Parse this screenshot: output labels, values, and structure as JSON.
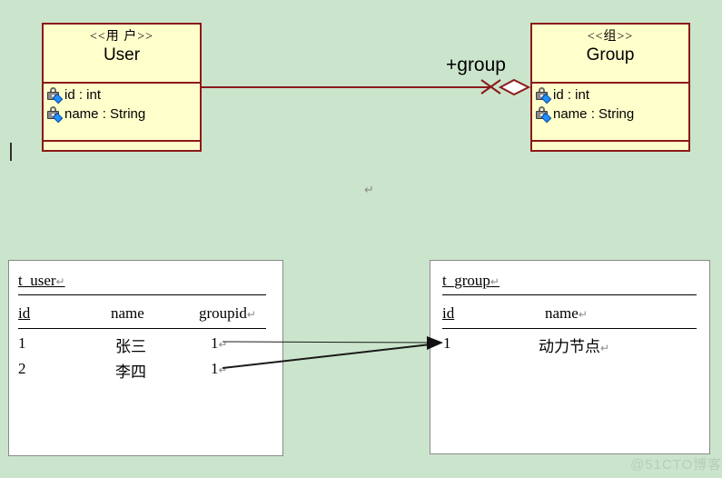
{
  "background_color": "#cbe5cc",
  "uml": {
    "line_color": "#8b1a1a",
    "fill_color": "#ffffcc",
    "association": {
      "role_label": "+group",
      "end_marker": "aggregation-diamond"
    },
    "classes": [
      {
        "stereotype": "<<用 户>>",
        "name": "User",
        "attributes": [
          {
            "visibility": "private",
            "text": "id : int"
          },
          {
            "visibility": "private",
            "text": "name : String"
          }
        ],
        "operations": []
      },
      {
        "stereotype": "<<组>>",
        "name": "Group",
        "attributes": [
          {
            "visibility": "private",
            "text": "id : int"
          },
          {
            "visibility": "private",
            "text": "name : String"
          }
        ],
        "operations": []
      }
    ]
  },
  "tables": {
    "border_color": "#8a8a8a",
    "fill_color": "#ffffff",
    "t_user": {
      "title": "t_user",
      "title_mark": "↵",
      "columns": [
        "id",
        "name",
        "groupid"
      ],
      "columns_mark": [
        "",
        "",
        "↵"
      ],
      "rows": [
        {
          "id": "1",
          "name": "张三",
          "groupid": "1",
          "mark": "↵"
        },
        {
          "id": "2",
          "name": "李四",
          "groupid": "1",
          "mark": "↵"
        }
      ]
    },
    "t_group": {
      "title": "t_group",
      "title_mark": "↵",
      "columns": [
        "id",
        "name"
      ],
      "columns_mark": [
        "",
        "↵"
      ],
      "rows": [
        {
          "id": "1",
          "name": "动力节点",
          "mark": "↵"
        }
      ]
    }
  },
  "annotations": {
    "stray_paragraph_mark": "↵",
    "text_caret": "|"
  },
  "watermark": "@51CTO博客"
}
